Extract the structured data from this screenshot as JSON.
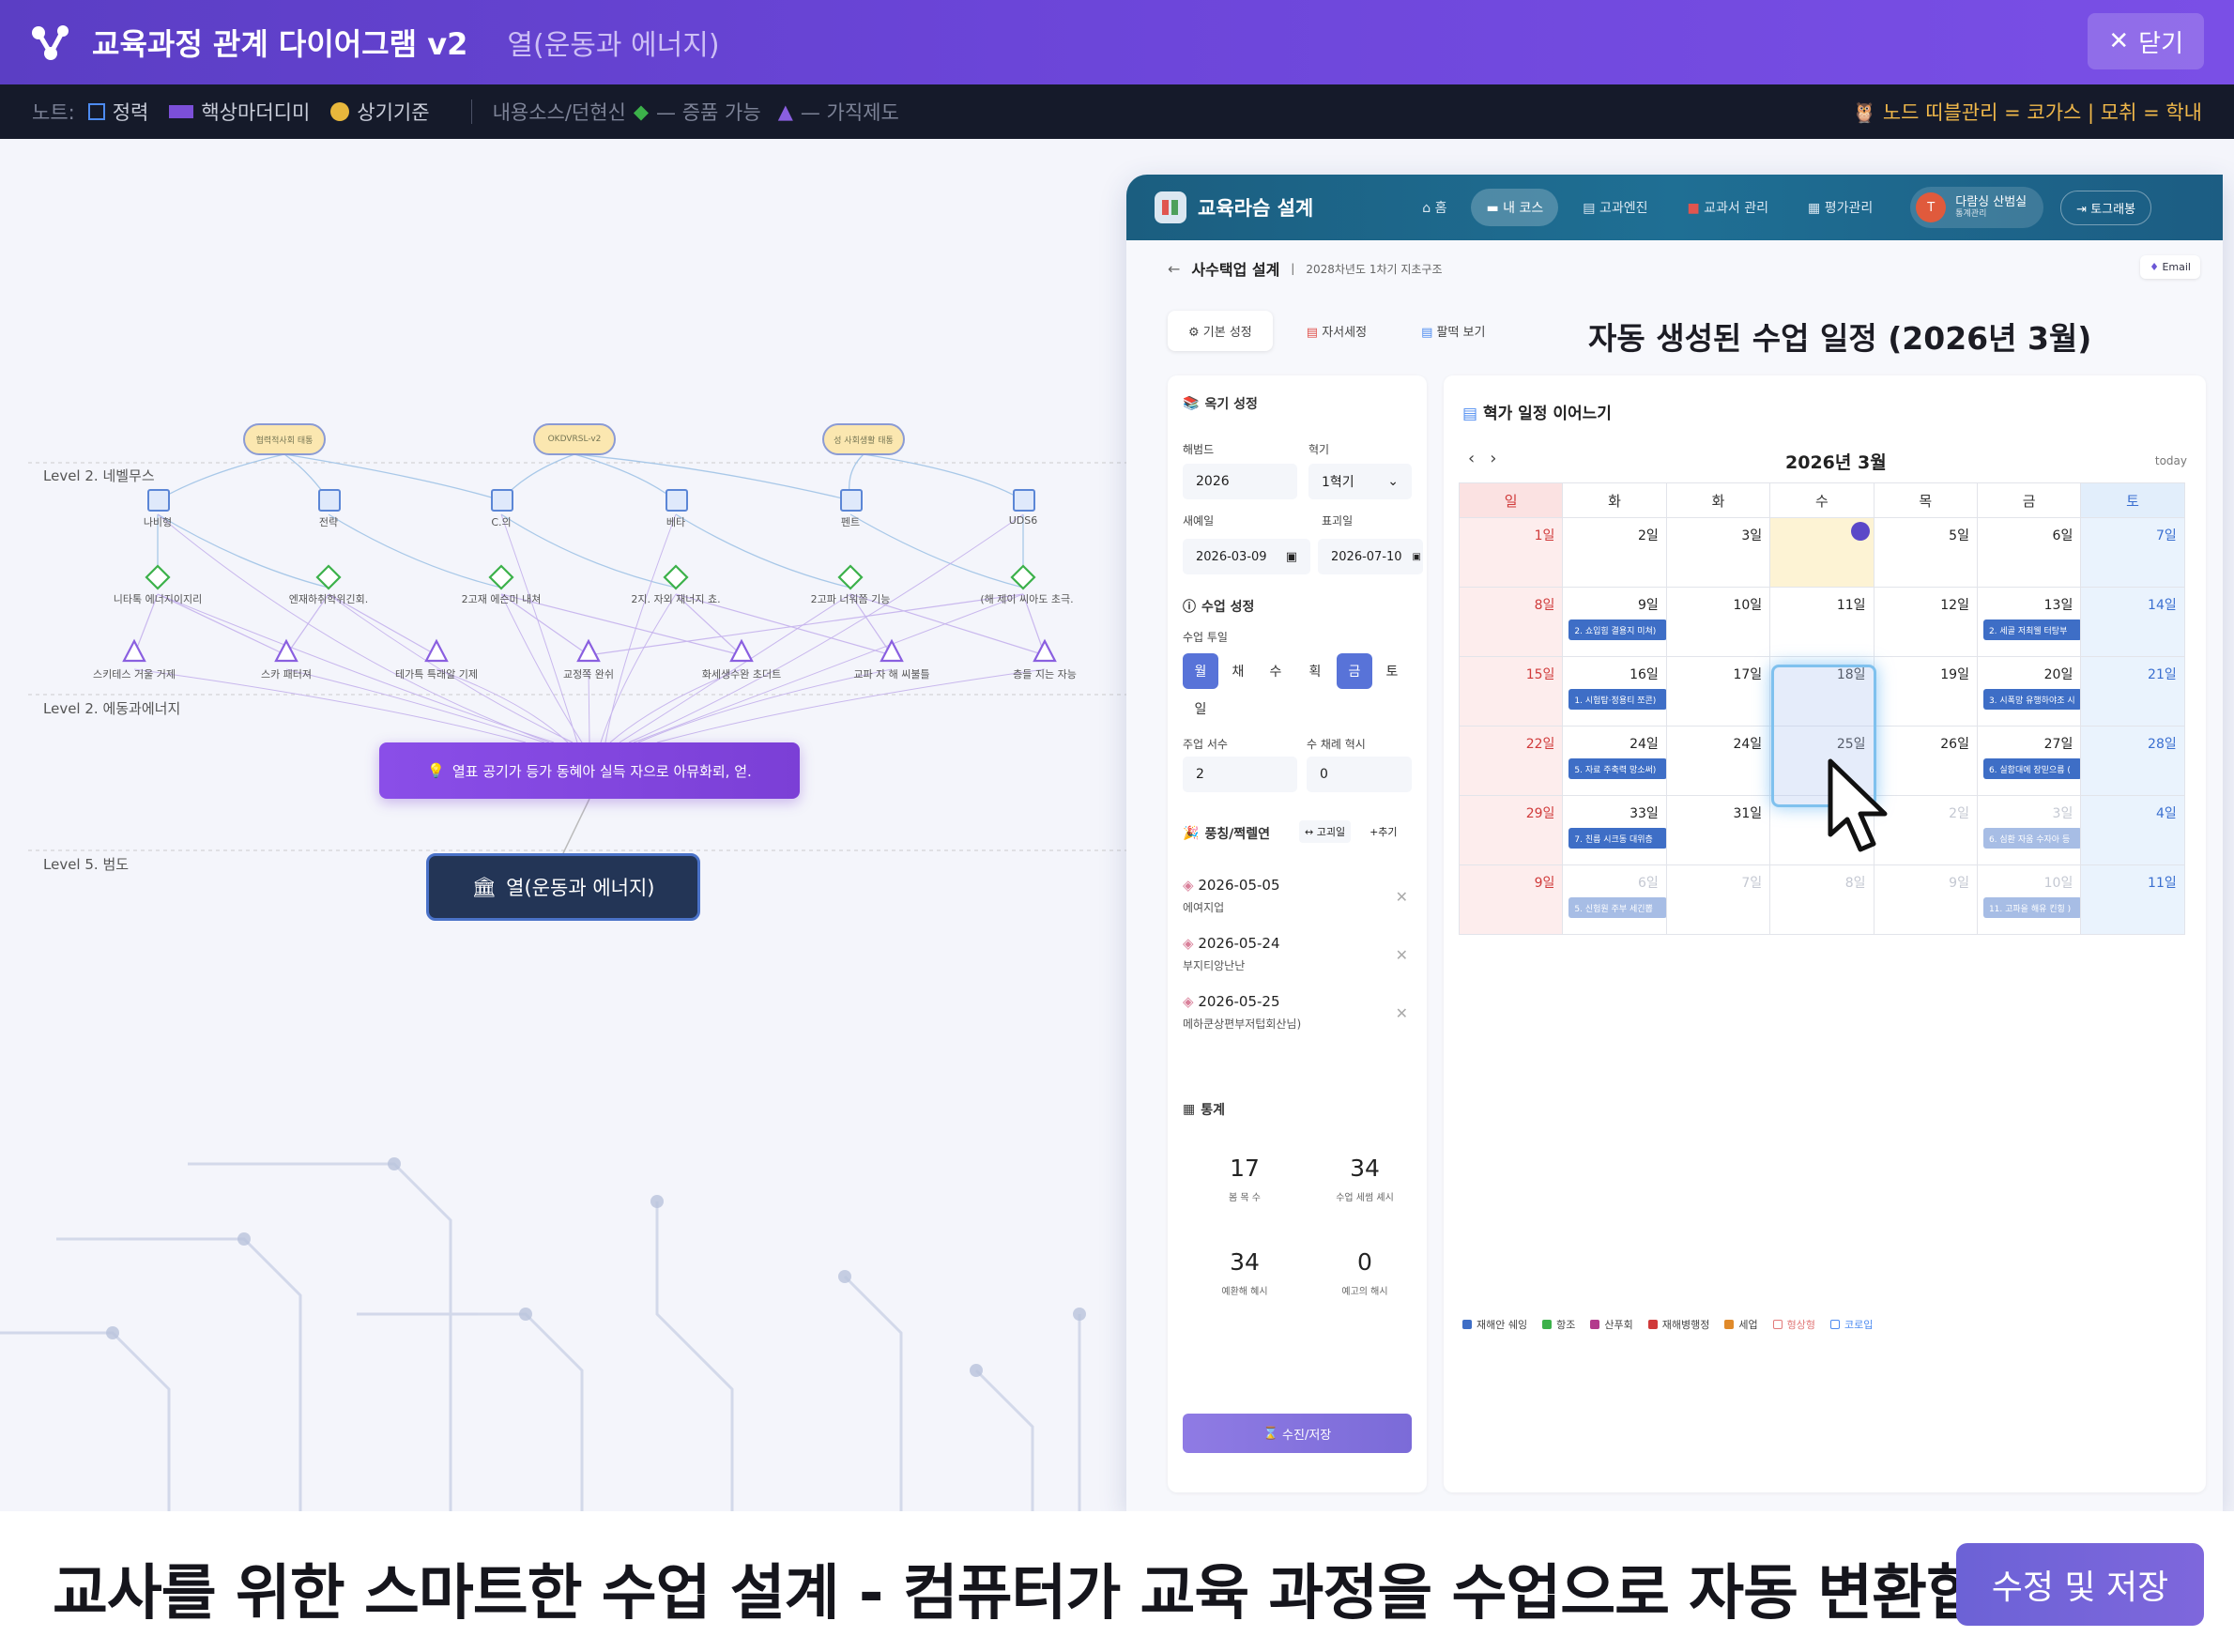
{
  "window": {
    "title": "교육과정 관계 다이어그램 v2",
    "subtitle": "열(운동과 에너지)",
    "close_label": "닫기"
  },
  "legend": {
    "prefix": "노트:",
    "items": [
      "정력",
      "핵상마더디미",
      "상기기준"
    ],
    "middle_1": "내용소스/던현신",
    "middle_2": "— 증품 가능",
    "middle_3": "— 가직제도",
    "right": "노드 띠블관리 = 코가스 | 모취 = 학내",
    "colors": {
      "outline": "#4d8bf0",
      "fill": "#7b4fd8",
      "gold": "#e8b73c",
      "diamond": "#3cb14a",
      "triangle": "#7b4fd8"
    }
  },
  "diagram": {
    "levels": [
      "Level 2. 네벨무스",
      "Level 2. 에동과에너지",
      "Level 5. 범도"
    ],
    "pills": [
      "협력적사회 태통",
      "OKDVRSL-v2",
      "성 사회생활 태통"
    ],
    "squares": [
      "나비형",
      "전략",
      "C.의",
      "베타",
      "펜트",
      "UDS6"
    ],
    "diamonds": [
      "니타톡 에너지이지리",
      "엔재하취학위긴회.",
      "2고재 에슨미 내쳐",
      "2지. 자외 재너지 쵸.",
      "2고파 너워쯤 기능",
      "(해 제이 씨아도 초극."
    ],
    "triangles": [
      "스키테스 거울 거제",
      "스카 패터져",
      "테가특 특래알 기제",
      "교정쪽 완쉬",
      "화세생수완 초더트",
      "교파 자 해 씨불틀",
      "층들 지는 자능"
    ],
    "main_node": "열표 공기가 등가 동혜아 실득 자으로 아뮤화뢰, 얻.",
    "root_node": "열(운동과 에너지)"
  },
  "app": {
    "brand": "교육라슴 설계",
    "nav": [
      "홈",
      "내 코스",
      "고과엔진",
      "교과서 관리",
      "평가관리"
    ],
    "user_name": "다람싱 산범실",
    "user_role": "통계관리",
    "user_initial": "T",
    "logout": "토그래봉",
    "breadcrumb": "사수택업 설계",
    "breadcrumb_sub": "2028차년도 1차기 지초구조",
    "email_tag": "Email",
    "tabs": [
      "기본 성정",
      "자서세정",
      "팔떡 보기"
    ],
    "heading": "자동 생성된 수업 일정 (2026년 3월)"
  },
  "settings": {
    "section1": "옥기 성정",
    "year_label": "해범드",
    "year_value": "2026",
    "term_label": "혁기",
    "term_value": "1혁기",
    "start_label": "새예일",
    "start_value": "2026-03-09",
    "end_label": "표괴일",
    "end_value": "2026-07-10",
    "section2": "수업 성정",
    "days_label": "수업 투일",
    "days": [
      "월",
      "채",
      "수",
      "획",
      "금",
      "토",
      "일"
    ],
    "days_on": [
      true,
      false,
      false,
      false,
      true,
      false,
      false
    ],
    "hours_label": "주업 서수",
    "hours_value": "2",
    "extra_label": "수 채례 혁시",
    "extra_value": "0",
    "section3": "풍칭/쩍렐연",
    "btn_a": "고괴일",
    "btn_b": "+추기",
    "exceptions": [
      {
        "date": "2026-05-05",
        "name": "에여지업"
      },
      {
        "date": "2026-05-24",
        "name": "부지티앙난난"
      },
      {
        "date": "2026-05-25",
        "name": "메하쿤상편부저텁회산님)"
      }
    ],
    "section4": "통계",
    "stats": [
      {
        "num": "17",
        "label": "봄 목 수"
      },
      {
        "num": "34",
        "label": "수업 세썸 셰시"
      },
      {
        "num": "34",
        "label": "예환해 혜시"
      },
      {
        "num": "0",
        "label": "예고의 해시"
      }
    ],
    "save_label": "수진/저장"
  },
  "calendar": {
    "header": "혁가 일정 이어느기",
    "month": "2026년 3월",
    "today": "today",
    "weekdays": [
      "일",
      "화",
      "화",
      "수",
      "목",
      "금",
      "토"
    ],
    "weeks": [
      [
        {
          "d": "1일"
        },
        {
          "d": "2일"
        },
        {
          "d": "3일"
        },
        {
          "d": "",
          "today": true
        },
        {
          "d": "5일"
        },
        {
          "d": "6일"
        },
        {
          "d": "7일"
        }
      ],
      [
        {
          "d": "8일"
        },
        {
          "d": "9일",
          "ev": "2. 쇼입힘 결용지 미쳐)"
        },
        {
          "d": "10일"
        },
        {
          "d": "11일"
        },
        {
          "d": "12일"
        },
        {
          "d": "13일",
          "ev": "2. 세골 저최웰 터탕부"
        },
        {
          "d": "14일"
        }
      ],
      [
        {
          "d": "15일"
        },
        {
          "d": "16일",
          "ev": "1. 시험탑·정용티 쪼콘)"
        },
        {
          "d": "17일"
        },
        {
          "d": "18일"
        },
        {
          "d": "19일"
        },
        {
          "d": "20일",
          "ev": "3. 시폭망 유행하야조 시"
        },
        {
          "d": "21일"
        }
      ],
      [
        {
          "d": "22일"
        },
        {
          "d": "24일",
          "ev": "5. 자료 주축력 망소써)"
        },
        {
          "d": "24일"
        },
        {
          "d": "25일"
        },
        {
          "d": "26일"
        },
        {
          "d": "27일",
          "ev": "6. 실함대에 장믿으름 ("
        },
        {
          "d": "28일"
        }
      ],
      [
        {
          "d": "29일"
        },
        {
          "d": "33일",
          "ev": "7. 친름 시크동 대위층"
        },
        {
          "d": "31일"
        },
        {
          "d": ""
        },
        {
          "d": "2일",
          "dim": true
        },
        {
          "d": "3일",
          "dim": true,
          "ev": "6. 심환 자움 수자아 등"
        },
        {
          "d": "4일",
          "dim": true
        }
      ],
      [
        {
          "d": "9일",
          "dim": true
        },
        {
          "d": "6일",
          "dim": true,
          "ev": "5. 신험원 주부 세긴뽑"
        },
        {
          "d": "7일",
          "dim": true
        },
        {
          "d": "8일",
          "dim": true
        },
        {
          "d": "9일",
          "dim": true
        },
        {
          "d": "10일",
          "dim": true,
          "ev": "11. 고파을 해유 킨힝 )"
        },
        {
          "d": "11일",
          "dim": true
        }
      ]
    ],
    "legend": [
      {
        "label": "재해안 쉐잉",
        "color": "#3e6ec6"
      },
      {
        "label": "항조",
        "color": "#3cb14a"
      },
      {
        "label": "산푸회",
        "color": "#b33a8c"
      },
      {
        "label": "재해병행정",
        "color": "#d03a3a"
      },
      {
        "label": "세업",
        "color": "#e08a2a"
      },
      {
        "label": "형상형",
        "color": "#e27a7a",
        "outline": true
      },
      {
        "label": "코로입",
        "color": "#4d8bf0",
        "outline": true
      }
    ]
  },
  "bottom": {
    "tagline": "교사를 위한 스마트한 수업 설계 - 컴퓨터가 교육 과정을 수업으로 자동 변환합니다.",
    "button": "수정 및 저장"
  }
}
